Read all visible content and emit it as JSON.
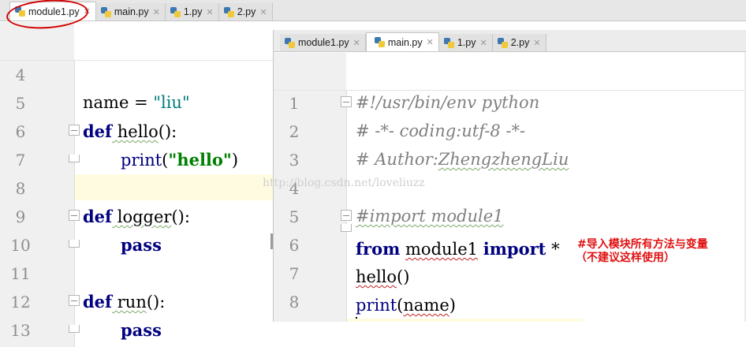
{
  "left_editor": {
    "tabs": [
      {
        "label": "module1.py",
        "active": true
      },
      {
        "label": "main.py",
        "active": false
      },
      {
        "label": "1.py",
        "active": false
      },
      {
        "label": "2.py",
        "active": false
      }
    ],
    "line_numbers": [
      "4",
      "5",
      "6",
      "7",
      "8",
      "9",
      "10",
      "11",
      "12",
      "13"
    ],
    "code": {
      "l5_name": "name",
      "l5_eq": " = ",
      "l5_str": "\"liu\"",
      "l6_def": "def",
      "l6_fn": " hello",
      "l6_rest": "():",
      "l7_print": "print",
      "l7_open": "(",
      "l7_str": "\"hello\"",
      "l7_close": ")",
      "l9_def": "def",
      "l9_fn": " logger",
      "l9_rest": "():",
      "l10_pass": "pass",
      "l12_def": "def",
      "l12_fn": " run",
      "l12_rest": "():",
      "l13_pass": "pass"
    }
  },
  "right_editor": {
    "tabs": [
      {
        "label": "module1.py",
        "active": false
      },
      {
        "label": "main.py",
        "active": true
      },
      {
        "label": "1.py",
        "active": false
      },
      {
        "label": "2.py",
        "active": false
      }
    ],
    "line_numbers": [
      "1",
      "2",
      "3",
      "4",
      "5",
      "6",
      "7",
      "8"
    ],
    "code": {
      "l1": "#!/usr/bin/env python",
      "l2": "# -*- coding:utf-8 -*-",
      "l3_prefix": "# Author:",
      "l3_name": "ZhengzhengLiu",
      "l5": "#import module1",
      "l6_from": "from",
      "l6_mod": "module1",
      "l6_import": "import",
      "l6_star": " *",
      "l7_fn": "hello",
      "l7_rest": "()",
      "l8_fn": "print",
      "l8_open": "(",
      "l8_arg": "name",
      "l8_close": ")"
    }
  },
  "annotation": {
    "line1": "#导入模块所有方法与变量",
    "line2": "（不建议这样使用）"
  },
  "watermark": "http://blog.csdn.net/loveliuzz",
  "colors": {
    "keyword": "#000080",
    "string": "#008000",
    "comment": "#808080",
    "annotation": "#e01010",
    "circle": "#d20000"
  }
}
